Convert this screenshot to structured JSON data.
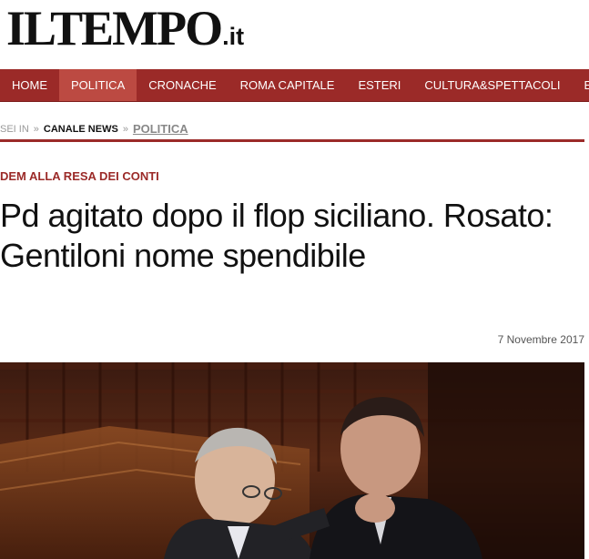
{
  "logo": {
    "main": "ILTEMPO",
    "suffix": ".it"
  },
  "nav": {
    "items": [
      {
        "label": "HOME",
        "active": false
      },
      {
        "label": "POLITICA",
        "active": true
      },
      {
        "label": "CRONACHE",
        "active": false
      },
      {
        "label": "ROMA CAPITALE",
        "active": false
      },
      {
        "label": "ESTERI",
        "active": false
      },
      {
        "label": "CULTURA&SPETTACOLI",
        "active": false
      },
      {
        "label": "ECONOMIA",
        "active": false
      }
    ]
  },
  "breadcrumb": {
    "prefix": "SEI IN",
    "separator": "»",
    "items": [
      "CANALE NEWS",
      "POLITICA"
    ]
  },
  "article": {
    "kicker": "DEM ALLA RESA DEI CONTI",
    "headline": "Pd agitato dopo il flop siciliano. Rosato: Gentiloni nome spendibile",
    "date": "7 Novembre 2017"
  },
  "colors": {
    "brand": "#9b2a28",
    "nav_active": "#bc4a42"
  }
}
